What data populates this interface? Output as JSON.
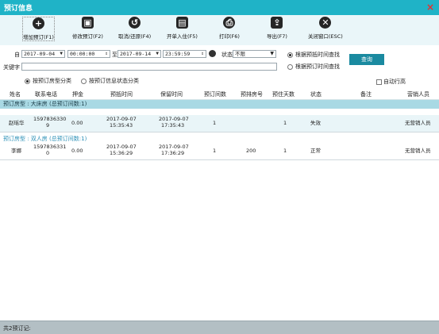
{
  "window": {
    "title": "预订信息",
    "close_glyph": "×"
  },
  "toolbar": [
    {
      "label": "增加预订(F1)",
      "icon": "plus-icon",
      "glyph": "+"
    },
    {
      "label": "修改预订(F2)",
      "icon": "edit-icon",
      "glyph": "▣"
    },
    {
      "label": "取消/还原(F4)",
      "icon": "undo-icon",
      "glyph": "↺"
    },
    {
      "label": "开单入住(F5)",
      "icon": "checkin-icon",
      "glyph": "▤"
    },
    {
      "label": "打印(F6)",
      "icon": "print-icon",
      "glyph": "⎙"
    },
    {
      "label": "导出(F7)",
      "icon": "export-icon",
      "glyph": "⇪"
    },
    {
      "label": "关闭窗口(ESC)",
      "icon": "close-window-icon",
      "glyph": "✕"
    }
  ],
  "filters": {
    "from_label": "自",
    "from_date": "2017-09-04",
    "from_time": "00:00:00",
    "to_label": "至",
    "to_date": "2017-09-14",
    "to_time": "23:59:59",
    "status_label": "状态",
    "status_value": "不限",
    "keyword_label": "关键字",
    "keyword_value": "",
    "search_by_arrive": "根据预抵时间查找",
    "search_by_book": "根据预订时间查找",
    "query_button": "查询",
    "group_by_room": "按预订房型分类",
    "group_by_status": "按预订信息状态分类",
    "auto_row_height": "自动行高"
  },
  "columns": [
    "姓名",
    "联系电话",
    "押金",
    "预抵时间",
    "保留时间",
    "预订间数",
    "预排房号",
    "预住天数",
    "状态",
    "备注",
    "营销人员"
  ],
  "groups": [
    {
      "title": "预订房型 : 大床房 (总预订间数:1)"
    },
    {
      "title": "预订房型 : 双人房 (总预订间数:1)"
    }
  ],
  "rows": [
    {
      "name": "赵瑶华",
      "phone_l1": "1597836330",
      "phone_l2": "9",
      "deposit": "0.00",
      "arrive_l1": "2017-09-07",
      "arrive_l2": "15:35:43",
      "retain_l1": "2017-09-07",
      "retain_l2": "17:35:43",
      "rooms": "1",
      "room_no": "",
      "days": "1",
      "status": "失效",
      "note": "",
      "sales": "无营销人员"
    },
    {
      "name": "李娜",
      "phone_l1": "1597836331",
      "phone_l2": "0",
      "deposit": "0.00",
      "arrive_l1": "2017-09-07",
      "arrive_l2": "15:36:29",
      "retain_l1": "2017-09-07",
      "retain_l2": "17:36:29",
      "rooms": "1",
      "room_no": "200",
      "days": "1",
      "status": "正常",
      "note": "",
      "sales": "无营销人员"
    }
  ],
  "statusbar": {
    "text": "共2预订记:"
  }
}
